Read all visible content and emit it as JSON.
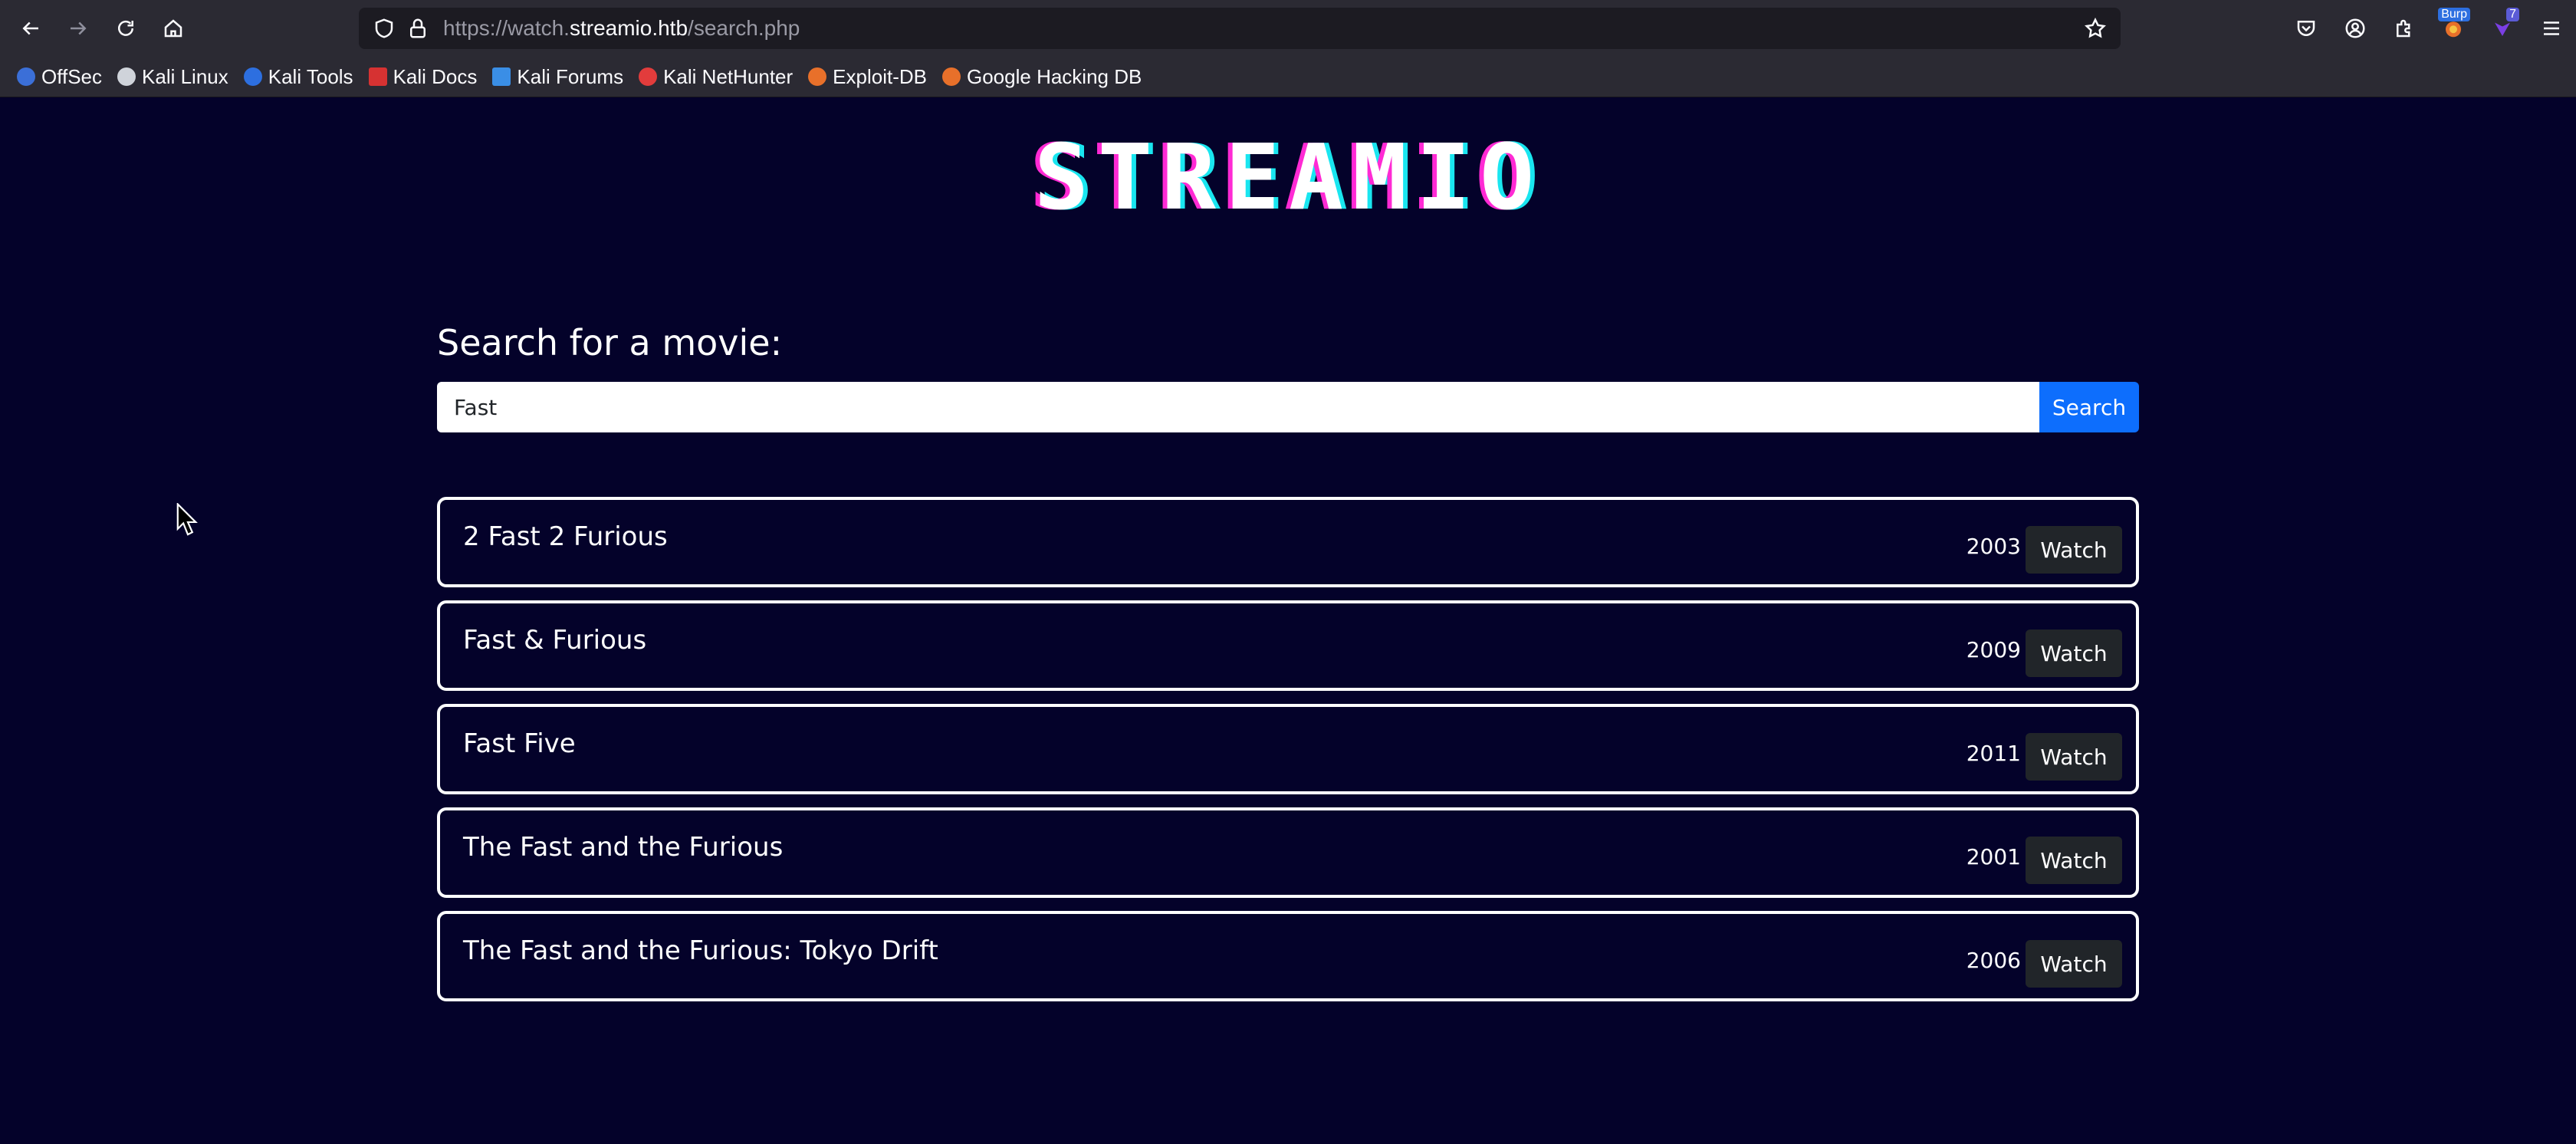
{
  "browser": {
    "url_scheme": "https://watch.",
    "url_host": "streamio.htb",
    "url_path": "/search.php",
    "burp_badge": "Burp",
    "ext_badge": "7",
    "bookmarks": [
      {
        "label": "OffSec",
        "color": "#3b6fd8"
      },
      {
        "label": "Kali Linux",
        "color": "#cfd3da"
      },
      {
        "label": "Kali Tools",
        "color": "#2d6fe0"
      },
      {
        "label": "Kali Docs",
        "color": "#d63232"
      },
      {
        "label": "Kali Forums",
        "color": "#3a8ee6"
      },
      {
        "label": "Kali NetHunter",
        "color": "#e23c3c"
      },
      {
        "label": "Exploit-DB",
        "color": "#e8702a"
      },
      {
        "label": "Google Hacking DB",
        "color": "#e8702a"
      }
    ]
  },
  "page": {
    "logo": "STREAMIO",
    "search_heading": "Search for a movie:",
    "search_value": "Fast",
    "search_button": "Search",
    "watch_label": "Watch",
    "results": [
      {
        "title": "2 Fast 2 Furious",
        "year": "2003"
      },
      {
        "title": "Fast & Furious",
        "year": "2009"
      },
      {
        "title": "Fast Five",
        "year": "2011"
      },
      {
        "title": "The Fast and the Furious",
        "year": "2001"
      },
      {
        "title": "The Fast and the Furious: Tokyo Drift",
        "year": "2006"
      }
    ]
  },
  "colors": {
    "background": "#04022a",
    "primary": "#0d6efd",
    "logo_magenta": "#ff2ad4",
    "logo_cyan": "#19e6f0"
  }
}
